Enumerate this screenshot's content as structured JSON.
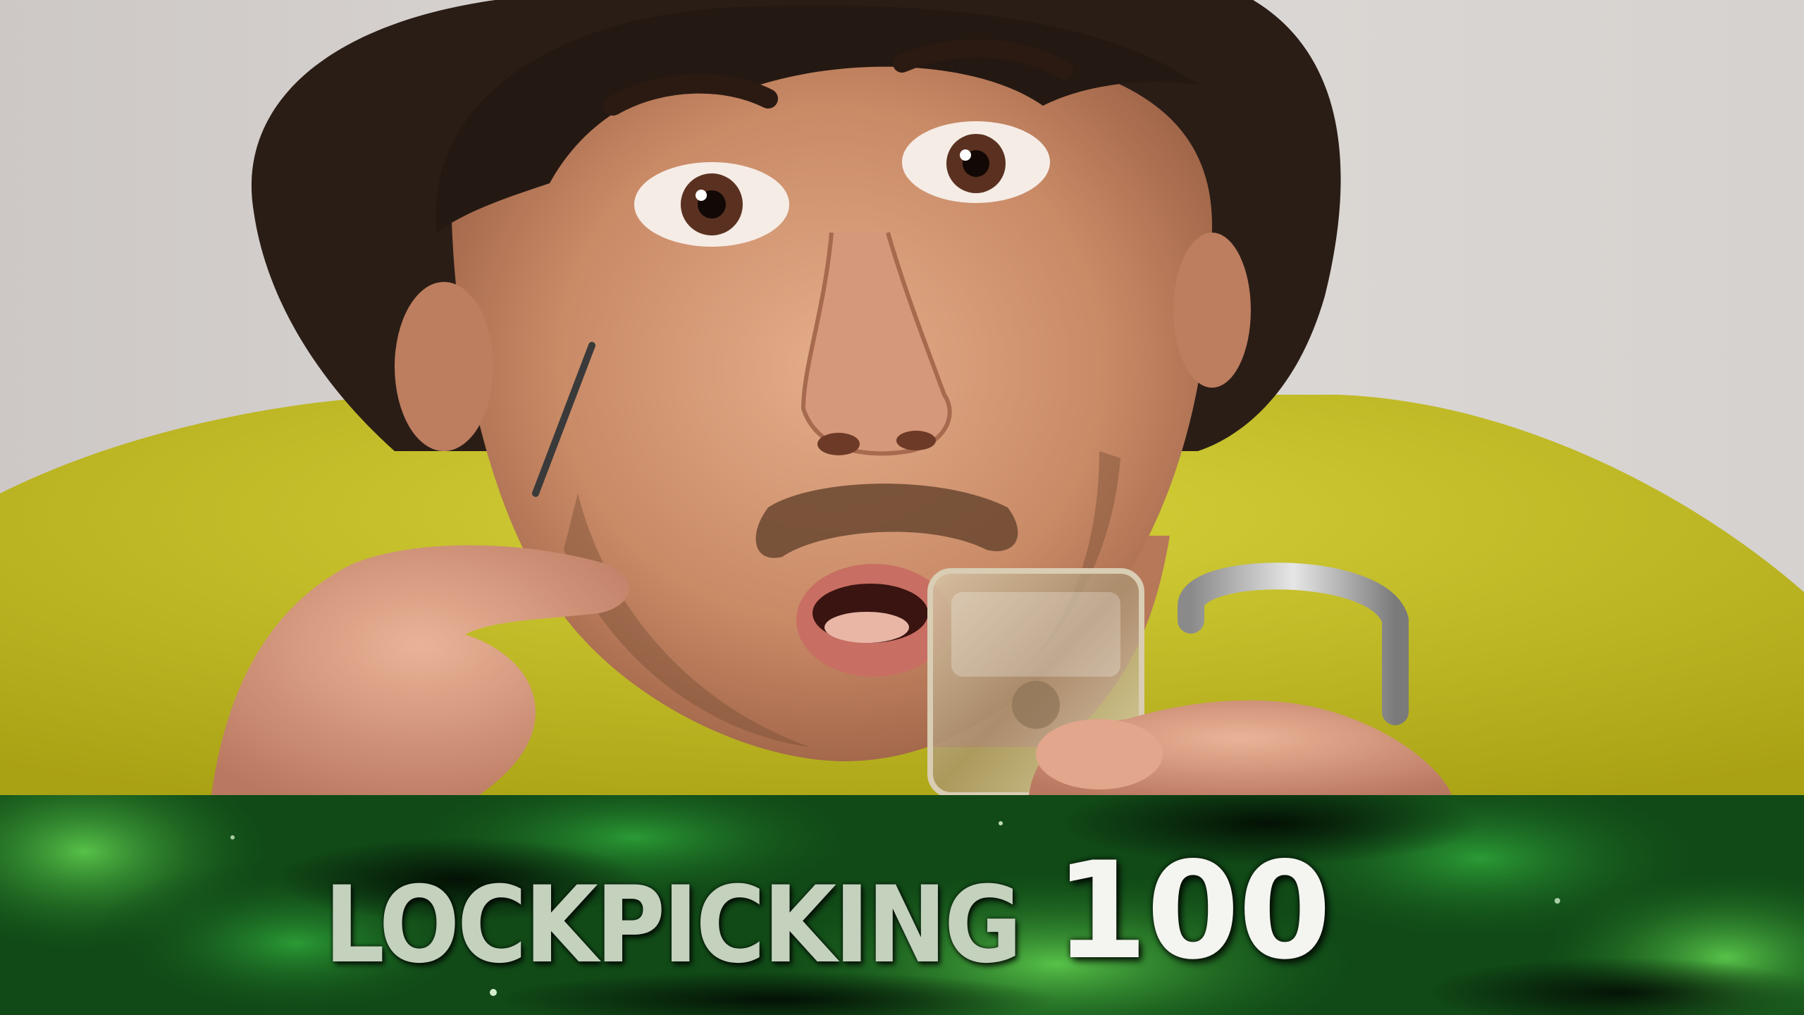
{
  "skill": {
    "name": "LOCKPICKING",
    "level": "100"
  },
  "colors": {
    "banner_green": "#1f7a25",
    "banner_dark": "#0b3310",
    "shirt_yellow": "#c8c22a",
    "background_wall": "#d8d4d1"
  },
  "photo": {
    "description_icon": "person-picking-padlock"
  }
}
